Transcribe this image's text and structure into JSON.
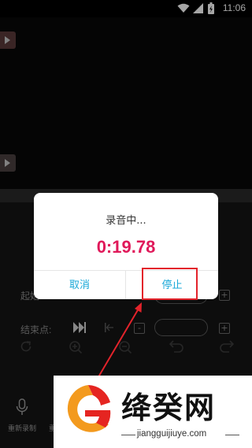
{
  "status_bar": {
    "time": "11:06",
    "icons": [
      "wifi-icon",
      "signal-icon",
      "battery-icon"
    ]
  },
  "controls": {
    "start_label": "起始",
    "end_label": "结束点:"
  },
  "toolbar": {
    "record_again_label": "重新录制",
    "second_label": "重"
  },
  "dialog": {
    "title": "录音中...",
    "timer": "0:19.78",
    "cancel_label": "取消",
    "stop_label": "停止"
  },
  "watermark": {
    "brand": "绛癸网",
    "url": "jiangguijiuye.com"
  },
  "colors": {
    "timer": "#e0195a",
    "button_text": "#1aa8d8",
    "highlight": "#e3232b",
    "logo_orange": "#f39a1e",
    "logo_red": "#e52521"
  }
}
